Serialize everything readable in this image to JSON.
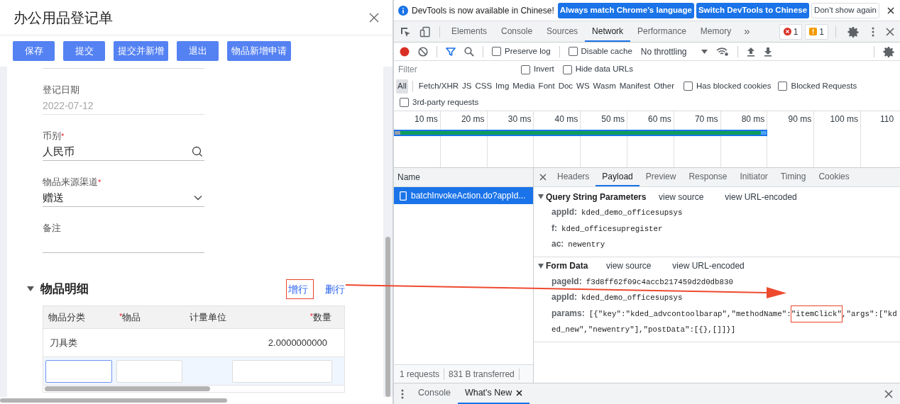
{
  "form": {
    "title": "办公用品登记单",
    "buttons": [
      "保存",
      "提交",
      "提交并新增",
      "退出",
      "物品新增申请"
    ],
    "fields": [
      {
        "label": "登记日期",
        "value": "2022-07-12",
        "kind": "date",
        "disabled": true
      },
      {
        "label": "币别",
        "marker": "*",
        "value": "人民币",
        "kind": "lookup",
        "disabled": false
      },
      {
        "label": "物品来源渠道",
        "marker": "*",
        "value": "赠送",
        "kind": "select",
        "disabled": false
      },
      {
        "label": "备注",
        "kind": "text",
        "disabled": false
      }
    ],
    "section": {
      "title": "物品明细",
      "expanded": true,
      "actions": [
        "增行",
        "删行"
      ]
    },
    "table": {
      "columns": [
        {
          "label": "物品分类"
        },
        {
          "label": "物品",
          "marker": "*"
        },
        {
          "label": "计量单位"
        },
        {
          "label": "数量",
          "marker": "*"
        }
      ],
      "rows": [
        {
          "kind": "data",
          "cells": [
            "刀具类",
            null,
            null,
            "2.0000000000"
          ]
        },
        {
          "kind": "edit",
          "inputs": [
            {
              "kind": "input",
              "focused": true
            },
            {
              "kind": "input",
              "focused": false
            },
            {
              "kind": "blank"
            },
            {
              "kind": "input",
              "focused": false
            }
          ]
        }
      ]
    }
  },
  "devtools": {
    "infobar": {
      "message": "DevTools is now available in Chinese!",
      "buttons": [
        {
          "label": "Always match Chrome's language",
          "primary": true
        },
        {
          "label": "Switch DevTools to Chinese",
          "primary": true
        },
        {
          "label": "Don't show again",
          "primary": false
        }
      ]
    },
    "tabs": [
      {
        "label": "Elements",
        "selected": false
      },
      {
        "label": "Console",
        "selected": false
      },
      {
        "label": "Sources",
        "selected": false
      },
      {
        "label": "Network",
        "selected": true
      },
      {
        "label": "Performance",
        "selected": false
      },
      {
        "label": "Memory",
        "selected": false
      }
    ],
    "more": "»",
    "errors": "1",
    "warnings": "1",
    "toolbar": {
      "recording": true,
      "filter_on": true,
      "options": [
        {
          "label": "Preserve log",
          "checked": false
        },
        {
          "label": "Disable cache",
          "checked": false
        }
      ],
      "throttling": "No throttling"
    },
    "filter": {
      "placeholder": "Filter",
      "options": [
        {
          "label": "Invert",
          "checked": false
        },
        {
          "label": "Hide data URLs",
          "checked": false
        }
      ]
    },
    "types": [
      {
        "label": "All",
        "selected": true
      },
      {
        "label": "Fetch/XHR",
        "selected": false
      },
      {
        "label": "JS",
        "selected": false
      },
      {
        "label": "CSS",
        "selected": false
      },
      {
        "label": "Img",
        "selected": false
      },
      {
        "label": "Media",
        "selected": false
      },
      {
        "label": "Font",
        "selected": false
      },
      {
        "label": "Doc",
        "selected": false
      },
      {
        "label": "WS",
        "selected": false
      },
      {
        "label": "Wasm",
        "selected": false
      },
      {
        "label": "Manifest",
        "selected": false
      },
      {
        "label": "Other",
        "selected": false
      }
    ],
    "type_options": [
      {
        "label": "Has blocked cookies",
        "checked": false
      },
      {
        "label": "Blocked Requests",
        "checked": false
      }
    ],
    "third_party": {
      "label": "3rd-party requests",
      "checked": false
    },
    "timeline": {
      "ticks": [
        "10 ms",
        "20 ms",
        "30 ms",
        "40 ms",
        "50 ms",
        "60 ms",
        "70 ms",
        "80 ms",
        "90 ms",
        "100 ms",
        "110"
      ]
    },
    "requests": {
      "header": "Name",
      "rows": [
        {
          "name": "batchInvokeAction.do?appId...",
          "selected": true
        }
      ],
      "summary": [
        "1 requests",
        "831 B transferred"
      ]
    },
    "details": {
      "tabs": [
        {
          "label": "Headers",
          "selected": false
        },
        {
          "label": "Payload",
          "selected": true
        },
        {
          "label": "Preview",
          "selected": false
        },
        {
          "label": "Response",
          "selected": false
        },
        {
          "label": "Initiator",
          "selected": false
        },
        {
          "label": "Timing",
          "selected": false
        },
        {
          "label": "Cookies",
          "selected": false
        }
      ],
      "sections": [
        {
          "title": "Query String Parameters",
          "expanded": true,
          "links": [
            "view source",
            "view URL-encoded"
          ],
          "params": [
            {
              "key": "appId:",
              "value": "kded_demo_officesupsys"
            },
            {
              "key": "f:",
              "value": "kded_officesupregister"
            },
            {
              "key": "ac:",
              "value": "newentry"
            }
          ]
        },
        {
          "title": "Form Data",
          "expanded": true,
          "links": [
            "view source",
            "view URL-encoded"
          ],
          "params": [
            {
              "key": "pageId:",
              "value": "f3d8ff62f09c4accb217459d2d0db830"
            },
            {
              "key": "appId:",
              "value": "kded_demo_officesupsys"
            },
            {
              "key": "params:",
              "value_parts": [
                {
                  "text": "[{\"key\":\"kded_advcontoolbarap\",\"methodName\":",
                  "highlighted": false
                },
                {
                  "text": "\"itemClick\"",
                  "highlighted": true
                },
                {
                  "text": ",\"args\":[\"kded_new\",\"newentry\"],\"postData\":[{},[]]}]",
                  "highlighted": false
                }
              ]
            }
          ]
        }
      ]
    },
    "drawer": {
      "tabs": [
        {
          "label": "Console",
          "selected": false,
          "closable": false
        },
        {
          "label": "What's New",
          "selected": true,
          "closable": true
        }
      ]
    }
  }
}
